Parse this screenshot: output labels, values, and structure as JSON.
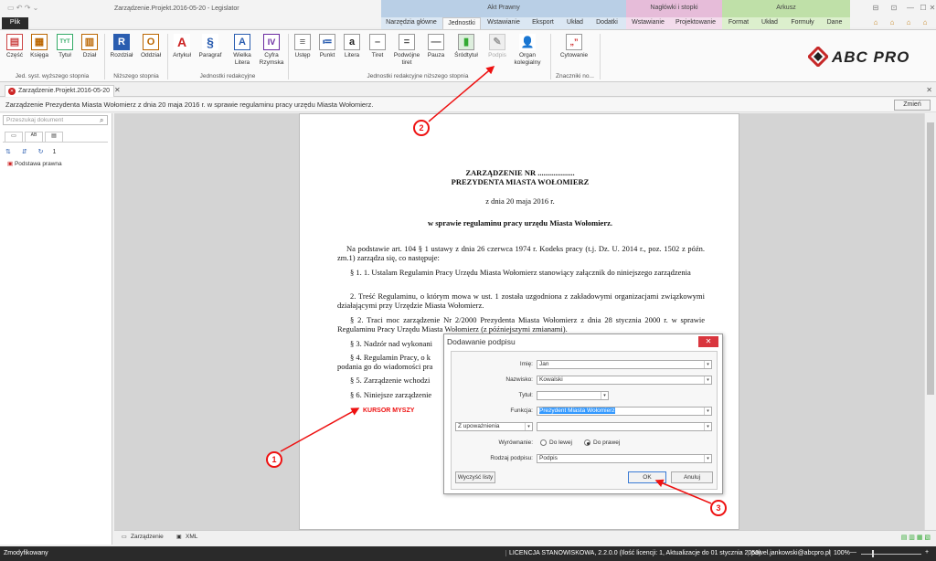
{
  "window": {
    "title": "Zarządzenie.Projekt.2016-05-20 - Legislator",
    "file_tab": "Plik"
  },
  "ribbon": {
    "context_groups": [
      {
        "label": "Akt Prawny",
        "color": "#b9cfe6"
      },
      {
        "label": "Nagłówki i stopki",
        "color": "#e6bcd9"
      },
      {
        "label": "Arkusz",
        "color": "#bfe0a8"
      }
    ],
    "tabs": [
      "Narzędzia główne",
      "Jednostki",
      "Wstawianie",
      "Eksport",
      "Układ",
      "Dodatki",
      "Wstawianie",
      "Projektowanie",
      "Format",
      "Układ",
      "Formuły",
      "Dane"
    ],
    "active_tab": "Jednostki",
    "buttons": [
      {
        "label": "Część",
        "glyph": "▤"
      },
      {
        "label": "Księga",
        "glyph": "▦"
      },
      {
        "label": "Tytuł",
        "glyph": "TYT"
      },
      {
        "label": "Dział",
        "glyph": "▥"
      },
      {
        "label": "Rozdział",
        "glyph": "R"
      },
      {
        "label": "Oddział",
        "glyph": "O"
      },
      {
        "label": "Artykuł",
        "glyph": "A"
      },
      {
        "label": "Paragraf",
        "glyph": "§"
      },
      {
        "label": "Wielka Litera",
        "glyph": "A"
      },
      {
        "label": "Cyfra Rzymska",
        "glyph": "IV"
      },
      {
        "label": "Ustęp",
        "glyph": "≡"
      },
      {
        "label": "Punkt",
        "glyph": "≔"
      },
      {
        "label": "Litera",
        "glyph": "a"
      },
      {
        "label": "Tiret",
        "glyph": "–"
      },
      {
        "label": "Podwójne tiret",
        "glyph": "="
      },
      {
        "label": "Pauza",
        "glyph": "—"
      },
      {
        "label": "Śródtytuł",
        "glyph": "▮"
      },
      {
        "label": "Podpis",
        "glyph": "✎"
      },
      {
        "label": "Organ kolegialny",
        "glyph": "👤"
      },
      {
        "label": "Cytowanie",
        "glyph": "„”"
      }
    ],
    "groups": [
      "Jed. syst. wyższego stopnia",
      "Niższego stopnia",
      "Jednostki redakcyjne",
      "Jednostki redakcyjne niższego stopnia",
      "Znaczniki no..."
    ],
    "logo_text": "ABC PRO"
  },
  "doc_tab": {
    "label": "Zarządzenie.Projekt.2016-05-20"
  },
  "info_bar": {
    "text": "Zarządzenie Prezydenta Miasta Wołomierz z dnia 20 maja 2016 r. w sprawie regulaminu pracy urzędu Miasta Wołomierz.",
    "button": "Zmień"
  },
  "left_panel": {
    "search_placeholder": "Przeszukaj dokument",
    "tree_item": "Podstawa prawna",
    "count": "1"
  },
  "document": {
    "title1": "ZARZĄDZENIE NR ...................",
    "title2": "PREZYDENTA MIASTA WOŁOMIERZ",
    "date": "z dnia 20 maja 2016 r.",
    "subject": "w sprawie regulaminu pracy urzędu Miasta Wołomierz.",
    "intro": "Na podstawie art. 104 § 1 ustawy z dnia 26 czerwca 1974 r. Kodeks pracy (t.j. Dz. U. 2014 r., poz. 1502 z późn. zm.1) zarządza się, co następuje:",
    "p1": "§ 1. 1. Ustalam Regulamin Pracy Urzędu Miasta Wołomierz stanowiący załącznik do niniejszego zarządzenia",
    "p1_2": "2. Treść Regulaminu, o którym mowa w ust. 1 została uzgodniona z zakładowymi organizacjami związkowymi działającymi przy Urzędzie Miasta Wołomierz.",
    "p2": "§ 2. Traci moc zarządzenie Nr 2/2000 Prezydenta Miasta Wołomierz z dnia 28 stycznia 2000 r. w sprawie Regulaminu Pracy Urzędu Miasta Wołomierz (z późniejszymi zmianami).",
    "p3": "§ 3. Nadzór nad wykonani",
    "p4a": "§ 4. Regulamin Pracy, o k",
    "p4b": "podania go do wiadomości pra",
    "p5": "§ 5. Zarządzenie wchodzi",
    "p6": "§ 6. Niniejsze zarządzenie",
    "cursor_note": "KURSOR MYSZY"
  },
  "dialog": {
    "title": "Dodawanie podpisu",
    "labels": {
      "imie": "Imię:",
      "nazwisko": "Nazwisko:",
      "tytul": "Tytuł:",
      "funkcja": "Funkcja:",
      "wyrownanie": "Wyrównanie:",
      "rodzaj": "Rodzaj podpisu:"
    },
    "values": {
      "imie": "Jan",
      "nazwisko": "Kowalski",
      "tytul": "",
      "funkcja": "Prezydent Miasta Wołomierz",
      "upowaznienie": "Z upoważnienia",
      "upowaznienie_value": "",
      "rodzaj": "Podpis"
    },
    "radio_left": "Do lewej",
    "radio_right": "Do prawej",
    "selected_alignment": "Do prawej",
    "clear_button": "Wyczyść listy",
    "ok_button": "OK",
    "cancel_button": "Anuluj"
  },
  "callouts": [
    "1",
    "2",
    "3"
  ],
  "bottom_tabs": [
    "Zarządzenie",
    "XML"
  ],
  "status_bar": {
    "left": "Zmodyfikowany",
    "license": "LICENCJA STANOWISKOWA, 2.2.0.0 (Ilość licencji: 1, Aktualizacje do 01 stycznia 2050)",
    "user": "pawel.jankowski@abcpro.pl",
    "zoom": "100%"
  },
  "colors": {
    "accent_red": "#e11111",
    "status_bg": "#2a2a2a",
    "active_tab_bg": "#fafafa"
  }
}
